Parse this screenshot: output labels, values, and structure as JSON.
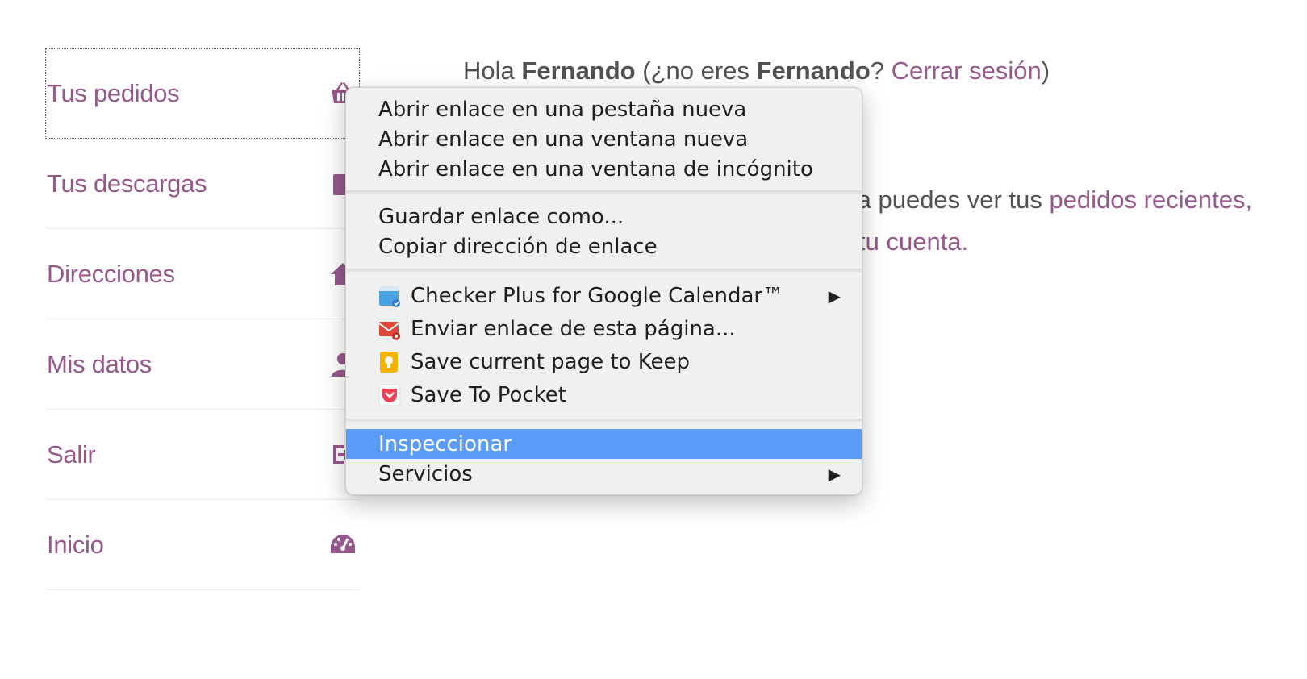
{
  "nav": {
    "items": [
      {
        "label": "Tus pedidos",
        "icon": "basket-icon",
        "active": true
      },
      {
        "label": "Tus descargas",
        "icon": "download-icon"
      },
      {
        "label": "Direcciones",
        "icon": "home-icon"
      },
      {
        "label": "Mis datos",
        "icon": "user-icon"
      },
      {
        "label": "Salir",
        "icon": "sign-out-icon"
      },
      {
        "label": "Inicio",
        "icon": "dashboard-icon"
      }
    ]
  },
  "content": {
    "greeting_hola": "Hola",
    "greeting_name": "Fernando",
    "greeting_middle": "(¿no eres",
    "greeting_name2": "Fernando",
    "greeting_q": "?",
    "logout_link": "Cerrar sesión",
    "greeting_close": ")",
    "line2_text": "ta puedes ver tus",
    "line2_link": "pedidos recientes,",
    "line3_link": "tu cuenta."
  },
  "context_menu": {
    "open_new_tab": "Abrir enlace en una pestaña nueva",
    "open_new_window": "Abrir enlace en una ventana nueva",
    "open_incognito": "Abrir enlace en una ventana de incógnito",
    "save_link_as": "Guardar enlace como...",
    "copy_link_address": "Copiar dirección de enlace",
    "checker_plus": "Checker Plus for Google Calendar™",
    "send_link": "Enviar enlace de esta página...",
    "save_to_keep": "Save current page to Keep",
    "save_to_pocket": "Save To Pocket",
    "inspect": "Inspeccionar",
    "services": "Servicios",
    "submenu_arrow": "▶"
  },
  "colors": {
    "accent": "#96588a",
    "highlight": "#5a9cf8",
    "menu_bg": "#f0f0f0"
  }
}
